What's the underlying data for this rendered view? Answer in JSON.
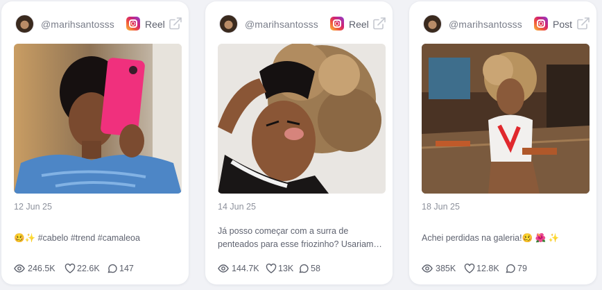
{
  "colors": {
    "background": "#f1f2f6",
    "card": "#ffffff",
    "text": "#5f6370",
    "muted": "#8d919c"
  },
  "cards": [
    {
      "handle": "@marihsantosss",
      "type": "Reel",
      "date": "12 Jun 25",
      "caption": "🥴✨ #cabelo #trend #camaleoa",
      "stats": {
        "views": "246.5K",
        "likes": "22.6K",
        "comments": "147"
      }
    },
    {
      "handle": "@marihsantosss",
      "type": "Reel",
      "date": "14 Jun 25",
      "caption": "Já posso começar com a surra de penteados para esse friozinho? Usariam…",
      "stats": {
        "views": "144.7K",
        "likes": "13K",
        "comments": "58"
      }
    },
    {
      "handle": "@marihsantosss",
      "type": "Post",
      "date": "18 Jun 25",
      "caption": "Achei perdidas na galeria!🥴 🌺 ✨",
      "stats": {
        "views": "385K",
        "likes": "12.8K",
        "comments": "79"
      }
    }
  ],
  "icons": [
    "instagram-icon",
    "external-link-icon",
    "eye-icon",
    "heart-icon",
    "comment-icon"
  ]
}
